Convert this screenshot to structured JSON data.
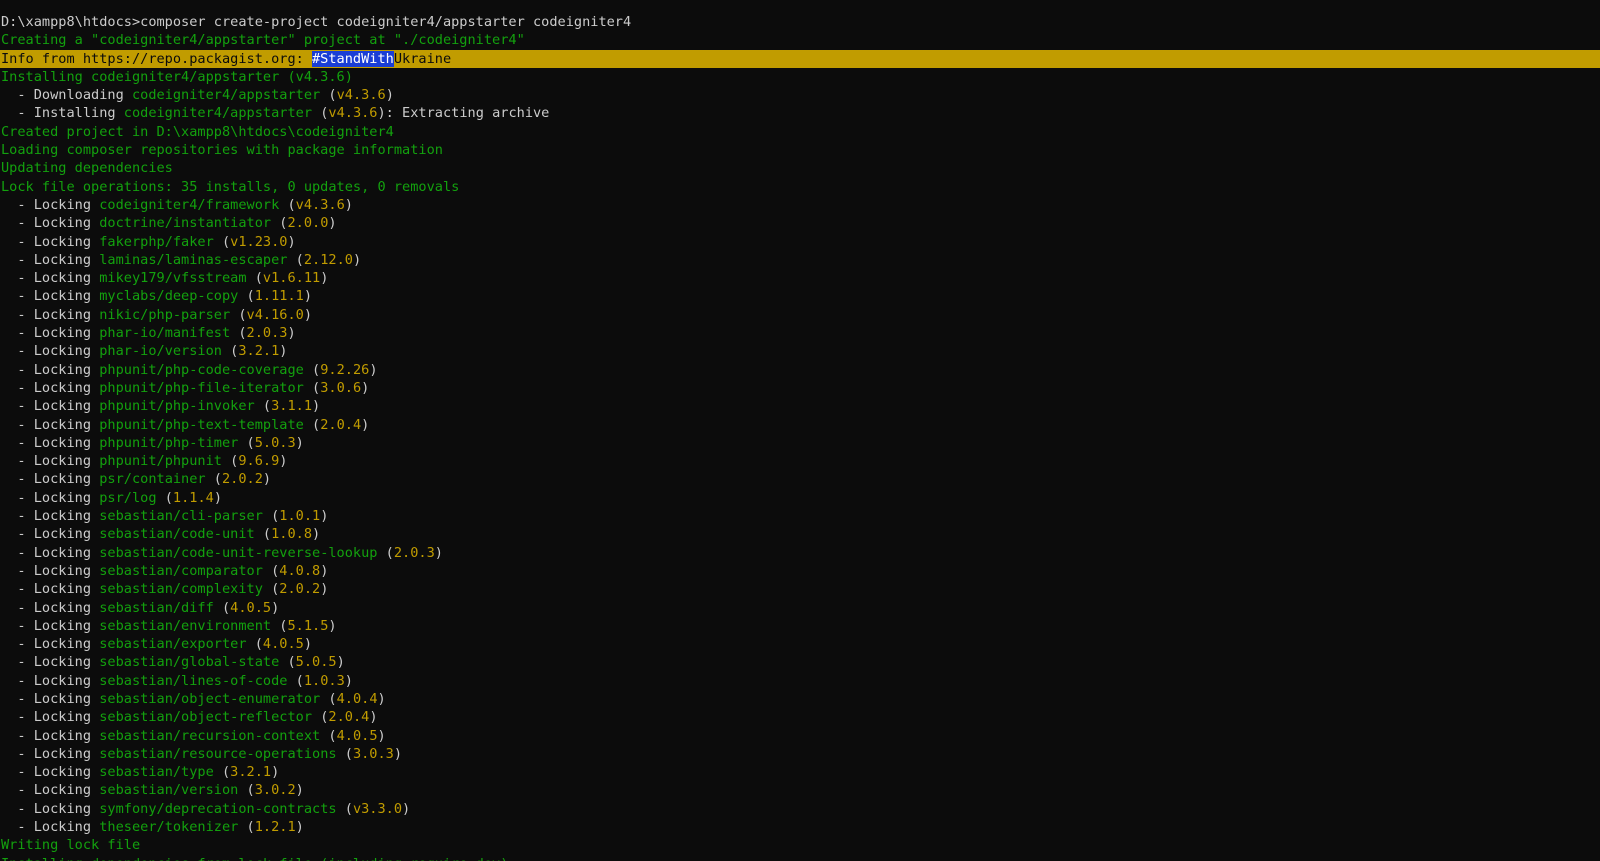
{
  "colors": {
    "background": "#0c0c0c",
    "text": "#cccccc",
    "green": "#13a10e",
    "yellow": "#c19c00",
    "selection": "#1a3ed6"
  },
  "terminal": {
    "lines": [
      {
        "segs": [
          [
            "white",
            "D:\\xampp8\\htdocs>composer create-project codeigniter4/appstarter codeigniter4"
          ]
        ]
      },
      {
        "segs": [
          [
            "green",
            "Creating a \"codeigniter4/appstarter\" project at \"./codeigniter4\""
          ]
        ]
      },
      {
        "banner": true,
        "segs": [
          [
            "dark",
            "Info from https://repo.packagist.org: "
          ],
          [
            "sel",
            "#StandWith"
          ],
          [
            "dark",
            "Ukraine"
          ]
        ]
      },
      {
        "segs": [
          [
            "green",
            "Installing codeigniter4/appstarter (v4.3.6)"
          ]
        ]
      },
      {
        "segs": [
          [
            "white",
            "  - Downloading "
          ],
          [
            "green",
            "codeigniter4/appstarter"
          ],
          [
            "white",
            " ("
          ],
          [
            "yellow",
            "v4.3.6"
          ],
          [
            "white",
            ")"
          ]
        ]
      },
      {
        "segs": [
          [
            "white",
            "  - Installing "
          ],
          [
            "green",
            "codeigniter4/appstarter"
          ],
          [
            "white",
            " ("
          ],
          [
            "yellow",
            "v4.3.6"
          ],
          [
            "white",
            "): Extracting archive"
          ]
        ]
      },
      {
        "segs": [
          [
            "green",
            "Created project in D:\\xampp8\\htdocs\\codeigniter4"
          ]
        ]
      },
      {
        "segs": [
          [
            "green",
            "Loading composer repositories with package information"
          ]
        ]
      },
      {
        "segs": [
          [
            "green",
            "Updating dependencies"
          ]
        ]
      },
      {
        "segs": [
          [
            "green",
            "Lock file operations: 35 installs, 0 updates, 0 removals"
          ]
        ]
      },
      {
        "segs": [
          [
            "white",
            "  - Locking "
          ],
          [
            "green",
            "codeigniter4/framework"
          ],
          [
            "white",
            " ("
          ],
          [
            "yellow",
            "v4.3.6"
          ],
          [
            "white",
            ")"
          ]
        ]
      },
      {
        "segs": [
          [
            "white",
            "  - Locking "
          ],
          [
            "green",
            "doctrine/instantiator"
          ],
          [
            "white",
            " ("
          ],
          [
            "yellow",
            "2.0.0"
          ],
          [
            "white",
            ")"
          ]
        ]
      },
      {
        "segs": [
          [
            "white",
            "  - Locking "
          ],
          [
            "green",
            "fakerphp/faker"
          ],
          [
            "white",
            " ("
          ],
          [
            "yellow",
            "v1.23.0"
          ],
          [
            "white",
            ")"
          ]
        ]
      },
      {
        "segs": [
          [
            "white",
            "  - Locking "
          ],
          [
            "green",
            "laminas/laminas-escaper"
          ],
          [
            "white",
            " ("
          ],
          [
            "yellow",
            "2.12.0"
          ],
          [
            "white",
            ")"
          ]
        ]
      },
      {
        "segs": [
          [
            "white",
            "  - Locking "
          ],
          [
            "green",
            "mikey179/vfsstream"
          ],
          [
            "white",
            " ("
          ],
          [
            "yellow",
            "v1.6.11"
          ],
          [
            "white",
            ")"
          ]
        ]
      },
      {
        "segs": [
          [
            "white",
            "  - Locking "
          ],
          [
            "green",
            "myclabs/deep-copy"
          ],
          [
            "white",
            " ("
          ],
          [
            "yellow",
            "1.11.1"
          ],
          [
            "white",
            ")"
          ]
        ]
      },
      {
        "segs": [
          [
            "white",
            "  - Locking "
          ],
          [
            "green",
            "nikic/php-parser"
          ],
          [
            "white",
            " ("
          ],
          [
            "yellow",
            "v4.16.0"
          ],
          [
            "white",
            ")"
          ]
        ]
      },
      {
        "segs": [
          [
            "white",
            "  - Locking "
          ],
          [
            "green",
            "phar-io/manifest"
          ],
          [
            "white",
            " ("
          ],
          [
            "yellow",
            "2.0.3"
          ],
          [
            "white",
            ")"
          ]
        ]
      },
      {
        "segs": [
          [
            "white",
            "  - Locking "
          ],
          [
            "green",
            "phar-io/version"
          ],
          [
            "white",
            " ("
          ],
          [
            "yellow",
            "3.2.1"
          ],
          [
            "white",
            ")"
          ]
        ]
      },
      {
        "segs": [
          [
            "white",
            "  - Locking "
          ],
          [
            "green",
            "phpunit/php-code-coverage"
          ],
          [
            "white",
            " ("
          ],
          [
            "yellow",
            "9.2.26"
          ],
          [
            "white",
            ")"
          ]
        ]
      },
      {
        "segs": [
          [
            "white",
            "  - Locking "
          ],
          [
            "green",
            "phpunit/php-file-iterator"
          ],
          [
            "white",
            " ("
          ],
          [
            "yellow",
            "3.0.6"
          ],
          [
            "white",
            ")"
          ]
        ]
      },
      {
        "segs": [
          [
            "white",
            "  - Locking "
          ],
          [
            "green",
            "phpunit/php-invoker"
          ],
          [
            "white",
            " ("
          ],
          [
            "yellow",
            "3.1.1"
          ],
          [
            "white",
            ")"
          ]
        ]
      },
      {
        "segs": [
          [
            "white",
            "  - Locking "
          ],
          [
            "green",
            "phpunit/php-text-template"
          ],
          [
            "white",
            " ("
          ],
          [
            "yellow",
            "2.0.4"
          ],
          [
            "white",
            ")"
          ]
        ]
      },
      {
        "segs": [
          [
            "white",
            "  - Locking "
          ],
          [
            "green",
            "phpunit/php-timer"
          ],
          [
            "white",
            " ("
          ],
          [
            "yellow",
            "5.0.3"
          ],
          [
            "white",
            ")"
          ]
        ]
      },
      {
        "segs": [
          [
            "white",
            "  - Locking "
          ],
          [
            "green",
            "phpunit/phpunit"
          ],
          [
            "white",
            " ("
          ],
          [
            "yellow",
            "9.6.9"
          ],
          [
            "white",
            ")"
          ]
        ]
      },
      {
        "segs": [
          [
            "white",
            "  - Locking "
          ],
          [
            "green",
            "psr/container"
          ],
          [
            "white",
            " ("
          ],
          [
            "yellow",
            "2.0.2"
          ],
          [
            "white",
            ")"
          ]
        ]
      },
      {
        "segs": [
          [
            "white",
            "  - Locking "
          ],
          [
            "green",
            "psr/log"
          ],
          [
            "white",
            " ("
          ],
          [
            "yellow",
            "1.1.4"
          ],
          [
            "white",
            ")"
          ]
        ]
      },
      {
        "segs": [
          [
            "white",
            "  - Locking "
          ],
          [
            "green",
            "sebastian/cli-parser"
          ],
          [
            "white",
            " ("
          ],
          [
            "yellow",
            "1.0.1"
          ],
          [
            "white",
            ")"
          ]
        ]
      },
      {
        "segs": [
          [
            "white",
            "  - Locking "
          ],
          [
            "green",
            "sebastian/code-unit"
          ],
          [
            "white",
            " ("
          ],
          [
            "yellow",
            "1.0.8"
          ],
          [
            "white",
            ")"
          ]
        ]
      },
      {
        "segs": [
          [
            "white",
            "  - Locking "
          ],
          [
            "green",
            "sebastian/code-unit-reverse-lookup"
          ],
          [
            "white",
            " ("
          ],
          [
            "yellow",
            "2.0.3"
          ],
          [
            "white",
            ")"
          ]
        ]
      },
      {
        "segs": [
          [
            "white",
            "  - Locking "
          ],
          [
            "green",
            "sebastian/comparator"
          ],
          [
            "white",
            " ("
          ],
          [
            "yellow",
            "4.0.8"
          ],
          [
            "white",
            ")"
          ]
        ]
      },
      {
        "segs": [
          [
            "white",
            "  - Locking "
          ],
          [
            "green",
            "sebastian/complexity"
          ],
          [
            "white",
            " ("
          ],
          [
            "yellow",
            "2.0.2"
          ],
          [
            "white",
            ")"
          ]
        ]
      },
      {
        "segs": [
          [
            "white",
            "  - Locking "
          ],
          [
            "green",
            "sebastian/diff"
          ],
          [
            "white",
            " ("
          ],
          [
            "yellow",
            "4.0.5"
          ],
          [
            "white",
            ")"
          ]
        ]
      },
      {
        "segs": [
          [
            "white",
            "  - Locking "
          ],
          [
            "green",
            "sebastian/environment"
          ],
          [
            "white",
            " ("
          ],
          [
            "yellow",
            "5.1.5"
          ],
          [
            "white",
            ")"
          ]
        ]
      },
      {
        "segs": [
          [
            "white",
            "  - Locking "
          ],
          [
            "green",
            "sebastian/exporter"
          ],
          [
            "white",
            " ("
          ],
          [
            "yellow",
            "4.0.5"
          ],
          [
            "white",
            ")"
          ]
        ]
      },
      {
        "segs": [
          [
            "white",
            "  - Locking "
          ],
          [
            "green",
            "sebastian/global-state"
          ],
          [
            "white",
            " ("
          ],
          [
            "yellow",
            "5.0.5"
          ],
          [
            "white",
            ")"
          ]
        ]
      },
      {
        "segs": [
          [
            "white",
            "  - Locking "
          ],
          [
            "green",
            "sebastian/lines-of-code"
          ],
          [
            "white",
            " ("
          ],
          [
            "yellow",
            "1.0.3"
          ],
          [
            "white",
            ")"
          ]
        ]
      },
      {
        "segs": [
          [
            "white",
            "  - Locking "
          ],
          [
            "green",
            "sebastian/object-enumerator"
          ],
          [
            "white",
            " ("
          ],
          [
            "yellow",
            "4.0.4"
          ],
          [
            "white",
            ")"
          ]
        ]
      },
      {
        "segs": [
          [
            "white",
            "  - Locking "
          ],
          [
            "green",
            "sebastian/object-reflector"
          ],
          [
            "white",
            " ("
          ],
          [
            "yellow",
            "2.0.4"
          ],
          [
            "white",
            ")"
          ]
        ]
      },
      {
        "segs": [
          [
            "white",
            "  - Locking "
          ],
          [
            "green",
            "sebastian/recursion-context"
          ],
          [
            "white",
            " ("
          ],
          [
            "yellow",
            "4.0.5"
          ],
          [
            "white",
            ")"
          ]
        ]
      },
      {
        "segs": [
          [
            "white",
            "  - Locking "
          ],
          [
            "green",
            "sebastian/resource-operations"
          ],
          [
            "white",
            " ("
          ],
          [
            "yellow",
            "3.0.3"
          ],
          [
            "white",
            ")"
          ]
        ]
      },
      {
        "segs": [
          [
            "white",
            "  - Locking "
          ],
          [
            "green",
            "sebastian/type"
          ],
          [
            "white",
            " ("
          ],
          [
            "yellow",
            "3.2.1"
          ],
          [
            "white",
            ")"
          ]
        ]
      },
      {
        "segs": [
          [
            "white",
            "  - Locking "
          ],
          [
            "green",
            "sebastian/version"
          ],
          [
            "white",
            " ("
          ],
          [
            "yellow",
            "3.0.2"
          ],
          [
            "white",
            ")"
          ]
        ]
      },
      {
        "segs": [
          [
            "white",
            "  - Locking "
          ],
          [
            "green",
            "symfony/deprecation-contracts"
          ],
          [
            "white",
            " ("
          ],
          [
            "yellow",
            "v3.3.0"
          ],
          [
            "white",
            ")"
          ]
        ]
      },
      {
        "segs": [
          [
            "white",
            "  - Locking "
          ],
          [
            "green",
            "theseer/tokenizer"
          ],
          [
            "white",
            " ("
          ],
          [
            "yellow",
            "1.2.1"
          ],
          [
            "white",
            ")"
          ]
        ]
      },
      {
        "segs": [
          [
            "green",
            "Writing lock file"
          ]
        ]
      },
      {
        "segs": [
          [
            "green",
            "Installing dependencies from lock file (including require-dev)"
          ]
        ]
      }
    ]
  }
}
